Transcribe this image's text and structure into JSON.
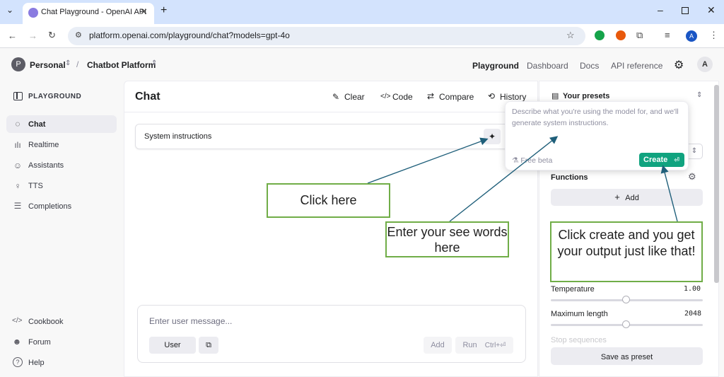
{
  "browser": {
    "tab_title": "Chat Playground - OpenAI API",
    "url": "platform.openai.com/playground/chat?models=gpt-4o",
    "profile_initial": "A"
  },
  "header": {
    "org_initial": "P",
    "org_name": "Personal",
    "project_name": "Chatbot Platform",
    "nav": [
      "Playground",
      "Dashboard",
      "Docs",
      "API reference"
    ],
    "user_initial": "A"
  },
  "sidebar": {
    "section_title": "PLAYGROUND",
    "items": [
      {
        "label": "Chat",
        "icon": "chat-bubble-icon"
      },
      {
        "label": "Realtime",
        "icon": "waveform-icon"
      },
      {
        "label": "Assistants",
        "icon": "robot-icon"
      },
      {
        "label": "TTS",
        "icon": "microphone-icon"
      },
      {
        "label": "Completions",
        "icon": "lines-icon"
      }
    ],
    "footer": [
      {
        "label": "Cookbook",
        "icon": "code-icon"
      },
      {
        "label": "Forum",
        "icon": "people-icon"
      },
      {
        "label": "Help",
        "icon": "help-icon"
      }
    ]
  },
  "chat": {
    "title": "Chat",
    "actions": {
      "clear": "Clear",
      "code": "Code",
      "compare": "Compare",
      "history": "History"
    },
    "system_label": "System instructions",
    "message_placeholder": "Enter user message...",
    "role_button": "User",
    "add_button": "Add",
    "run_button": "Run",
    "run_shortcut": "Ctrl+⏎"
  },
  "presets": {
    "label": "Your presets",
    "popover_text": "Describe what you're using the model for, and we'll generate system instructions.",
    "beta_label": "Free beta",
    "create_label": "Create",
    "functions_label": "Functions",
    "add_function_label": "Add",
    "temperature_label": "Temperature",
    "temperature_value": "1.00",
    "temperature_fraction": 0.5,
    "max_length_label": "Maximum length",
    "max_length_value": "2048",
    "max_length_fraction": 0.5,
    "stop_label": "Stop sequences",
    "save_label": "Save as preset"
  },
  "annotations": {
    "click_here": "Click here",
    "enter_words": "Enter your see words here",
    "click_create": "Click create and you get your output just like that!",
    "colors": {
      "border": "#70ad47",
      "arrow": "#1f5f7a"
    }
  },
  "colors": {
    "accent": "#10a37f",
    "tab_strip": "#d3e3fd"
  }
}
